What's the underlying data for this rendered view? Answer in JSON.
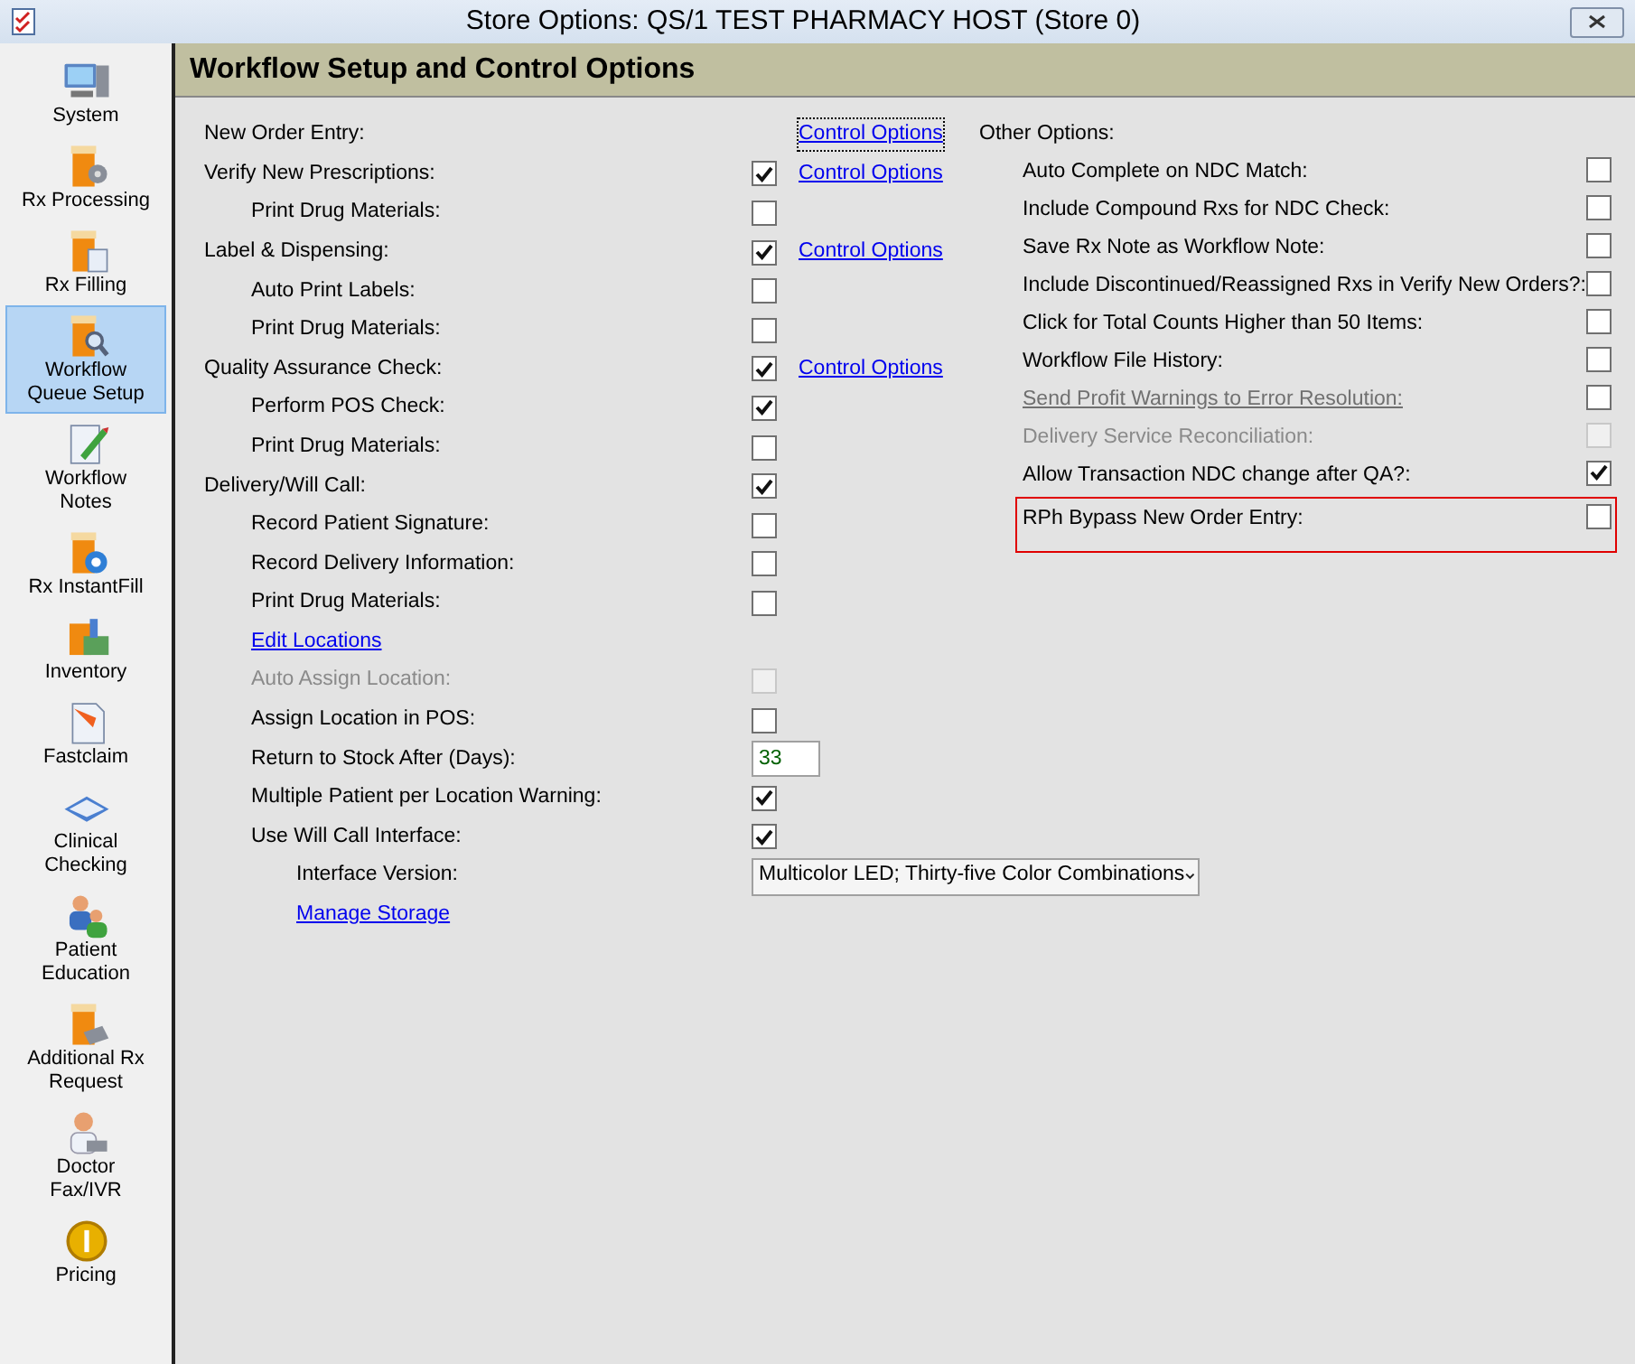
{
  "window": {
    "title": "Store Options: QS/1 TEST PHARMACY HOST (Store 0)"
  },
  "sidebar": {
    "items": [
      {
        "label": "System",
        "selected": false
      },
      {
        "label": "Rx Processing",
        "selected": false
      },
      {
        "label": "Rx Filling",
        "selected": false
      },
      {
        "label": "Workflow Queue Setup",
        "selected": true
      },
      {
        "label": "Workflow Notes",
        "selected": false
      },
      {
        "label": "Rx InstantFill",
        "selected": false
      },
      {
        "label": "Inventory",
        "selected": false
      },
      {
        "label": "Fastclaim",
        "selected": false
      },
      {
        "label": "Clinical Checking",
        "selected": false
      },
      {
        "label": "Patient Education",
        "selected": false
      },
      {
        "label": "Additional Rx Request",
        "selected": false
      },
      {
        "label": "Doctor Fax/IVR",
        "selected": false
      },
      {
        "label": "Pricing",
        "selected": false
      }
    ]
  },
  "header": {
    "title": "Workflow Setup and Control Options"
  },
  "workflow_options": [
    {
      "kind": "label",
      "label": "New Order Entry:",
      "link": "Control Options",
      "link_focused": true
    },
    {
      "kind": "checkbox",
      "label": "Verify New Prescriptions:",
      "checked": true,
      "disabled": false,
      "link": "Control Options",
      "link_focused": false,
      "children": [
        {
          "kind": "checkbox",
          "label": "Print Drug Materials:",
          "checked": false,
          "disabled": false
        }
      ]
    },
    {
      "kind": "checkbox",
      "label": "Label & Dispensing:",
      "checked": true,
      "disabled": false,
      "link": "Control Options",
      "link_focused": false,
      "children": [
        {
          "kind": "checkbox",
          "label": "Auto Print Labels:",
          "checked": false,
          "disabled": false
        },
        {
          "kind": "checkbox",
          "label": "Print Drug Materials:",
          "checked": false,
          "disabled": false
        }
      ]
    },
    {
      "kind": "checkbox",
      "label": "Quality Assurance Check:",
      "checked": true,
      "disabled": false,
      "link": "Control Options",
      "link_focused": false,
      "children": [
        {
          "kind": "checkbox",
          "label": "Perform POS Check:",
          "checked": true,
          "disabled": false
        },
        {
          "kind": "checkbox",
          "label": "Print Drug Materials:",
          "checked": false,
          "disabled": false
        }
      ]
    },
    {
      "kind": "checkbox",
      "label": "Delivery/Will Call:",
      "checked": true,
      "disabled": false,
      "children": [
        {
          "kind": "checkbox",
          "label": "Record Patient Signature:",
          "checked": false,
          "disabled": false
        },
        {
          "kind": "checkbox",
          "label": "Record Delivery Information:",
          "checked": false,
          "disabled": false
        },
        {
          "kind": "checkbox",
          "label": "Print Drug Materials:",
          "checked": false,
          "disabled": false
        },
        {
          "kind": "link",
          "label": "Edit Locations"
        },
        {
          "kind": "checkbox",
          "label": "Auto Assign Location:",
          "checked": false,
          "disabled": true
        },
        {
          "kind": "checkbox",
          "label": "Assign Location in POS:",
          "checked": false,
          "disabled": false
        },
        {
          "kind": "number",
          "label": "Return to Stock After (Days):",
          "value": "33"
        },
        {
          "kind": "checkbox",
          "label": "Multiple Patient per Location Warning:",
          "checked": true,
          "disabled": false
        },
        {
          "kind": "checkbox",
          "label": "Use Will Call Interface:",
          "checked": true,
          "disabled": false,
          "children": [
            {
              "kind": "select",
              "label": "Interface Version:",
              "value": "Multicolor LED; Thirty-five Color Combinations"
            },
            {
              "kind": "link",
              "label": "Manage Storage"
            }
          ]
        }
      ]
    }
  ],
  "other_options": {
    "title": "Other Options:",
    "items": [
      {
        "label": "Auto Complete on NDC Match:",
        "checked": false,
        "disabled": false,
        "linked": false,
        "highlighted": false
      },
      {
        "label": "Include Compound Rxs for NDC Check:",
        "checked": false,
        "disabled": false,
        "linked": false,
        "highlighted": false
      },
      {
        "label": "Save Rx Note as Workflow Note:",
        "checked": false,
        "disabled": false,
        "linked": false,
        "highlighted": false
      },
      {
        "label": "Include Discontinued/Reassigned Rxs in Verify New Orders?:",
        "checked": false,
        "disabled": false,
        "linked": false,
        "highlighted": false
      },
      {
        "label": "Click for Total Counts Higher than 50 Items:",
        "checked": false,
        "disabled": false,
        "linked": false,
        "highlighted": false
      },
      {
        "label": "Workflow File History:",
        "checked": false,
        "disabled": false,
        "linked": false,
        "highlighted": false
      },
      {
        "label": "Send Profit Warnings to Error Resolution:",
        "checked": false,
        "disabled": false,
        "linked": true,
        "highlighted": false
      },
      {
        "label": "Delivery Service Reconciliation:",
        "checked": false,
        "disabled": true,
        "linked": false,
        "highlighted": false
      },
      {
        "label": "Allow Transaction NDC change after QA?:",
        "checked": true,
        "disabled": false,
        "linked": false,
        "highlighted": false
      },
      {
        "label": "RPh Bypass New Order Entry:",
        "checked": false,
        "disabled": false,
        "linked": false,
        "highlighted": true
      }
    ]
  }
}
